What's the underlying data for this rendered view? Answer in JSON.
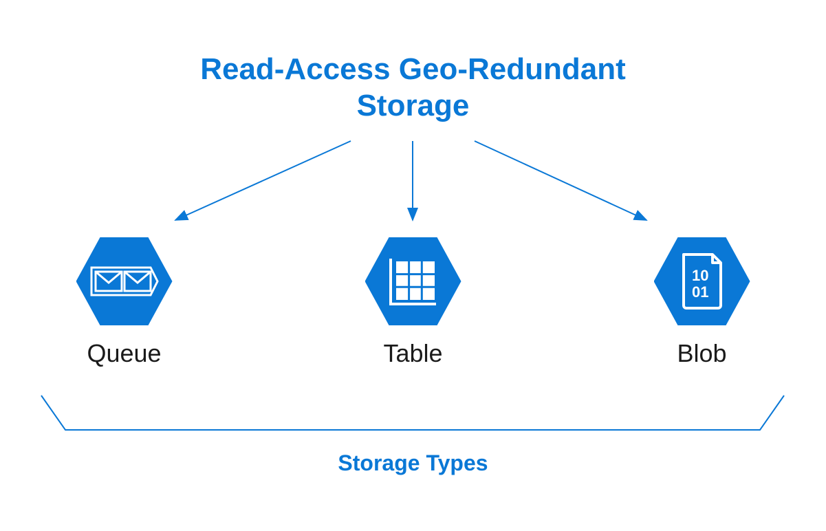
{
  "title_line1": "Read-Access Geo-Redundant",
  "title_line2": "Storage",
  "storage_types": [
    {
      "label": "Queue",
      "icon": "queue-icon"
    },
    {
      "label": "Table",
      "icon": "table-icon"
    },
    {
      "label": "Blob",
      "icon": "blob-icon"
    }
  ],
  "footer_label": "Storage Types",
  "colors": {
    "primary": "#0a78d6",
    "text": "#1a1a1a",
    "background": "#ffffff"
  }
}
